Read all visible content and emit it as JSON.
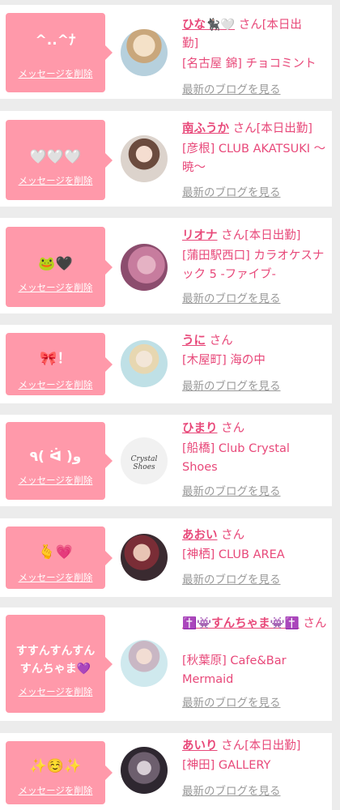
{
  "delete_label": "メッセージを削除",
  "blog_label": "最新のブログを見る",
  "cards": [
    {
      "message": "^..^ﾅ",
      "name": "ひな🐈‍⬛🤍",
      "suffix": "さん[本日出",
      "suffix2": "勤]",
      "shop": "[名古屋 錦] チョコミント"
    },
    {
      "message": "🤍🤍🤍",
      "name": "南ふうか",
      "suffix": "さん[本日出勤]",
      "shop": "[彦根] CLUB AKATSUKI 〜暁〜"
    },
    {
      "message": "🐸🖤",
      "name": "リオナ",
      "suffix": "さん[本日出勤]",
      "shop": "[蒲田駅西口] カラオケスナック 5 -ファイブ-"
    },
    {
      "message": "🎀！",
      "name": "うに",
      "suffix": "さん",
      "shop": "[木屋町] 海の中"
    },
    {
      "message": "٩( ᐛ )و",
      "name": "ひまり",
      "suffix": "さん",
      "shop": "[船橋] Club Crystal Shoes",
      "avatar_text": "Crystal Shoes"
    },
    {
      "message": "🫰💗",
      "name": "あおい",
      "suffix": "さん",
      "shop": "[神栖] CLUB AREA"
    },
    {
      "message": "すすんすんすんすんちゃま💜",
      "name": "✝️👾すんちゃま👾✝️",
      "suffix": "さん",
      "shop": "[秋葉原] Cafe&Bar Mermaid"
    },
    {
      "message": "✨☺️✨",
      "name": "あいり",
      "suffix": "さん[本日出勤]",
      "shop": "[神田] GALLERY"
    }
  ],
  "colors": {
    "accent": "#e8497a",
    "bubble": "#ff99aa",
    "muted": "#9a9a9a"
  }
}
